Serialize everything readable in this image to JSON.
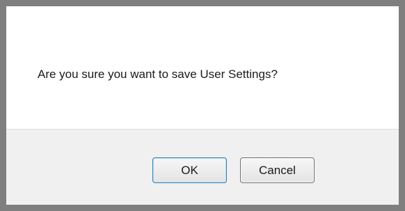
{
  "dialog": {
    "message": "Are you sure you want to save User Settings?",
    "buttons": {
      "ok_label": "OK",
      "cancel_label": "Cancel"
    }
  },
  "colors": {
    "frame": "#7f7f7f",
    "footer_background": "#f0f0f0",
    "default_button_border": "#3c7fb1"
  }
}
